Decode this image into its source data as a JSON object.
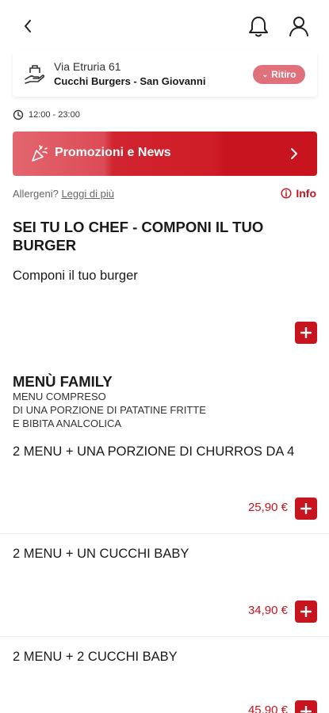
{
  "header": {
    "back_icon": "chevron-left-icon",
    "notifications_icon": "bell-icon",
    "profile_icon": "user-icon"
  },
  "store": {
    "street": "Via Etruria 61",
    "name": "Cucchi Burgers - San Giovanni",
    "mode_label": "Ritiro",
    "hours": "12:00 - 23:00"
  },
  "promo": {
    "label": "Promozioni e News"
  },
  "allergens": {
    "prefix": "Allergeni?",
    "link": "Leggi di più",
    "info_label": "Info"
  },
  "sections": [
    {
      "title": "SEI TU LO CHEF - COMPONI IL TUO BURGER",
      "items": [
        {
          "name": "Componi il tuo burger",
          "price": ""
        }
      ]
    },
    {
      "title": "MENÙ FAMILY",
      "subtitle_lines": [
        "MENU COMPRESO",
        "DI UNA PORZIONE DI PATATINE FRITTE",
        "E BIBITA ANALCOLICA"
      ],
      "items": [
        {
          "name": "2 MENU + UNA PORZIONE DI CHURROS DA 4",
          "price": "25,90 €"
        },
        {
          "name": "2 MENU + UN CUCCHI BABY",
          "price": "34,90 €"
        },
        {
          "name": "2 MENU + 2 CUCCHI BABY",
          "price": "45,90 €"
        }
      ]
    }
  ],
  "colors": {
    "brand_red": "#c8141f",
    "pill_pink": "#e0707a"
  }
}
